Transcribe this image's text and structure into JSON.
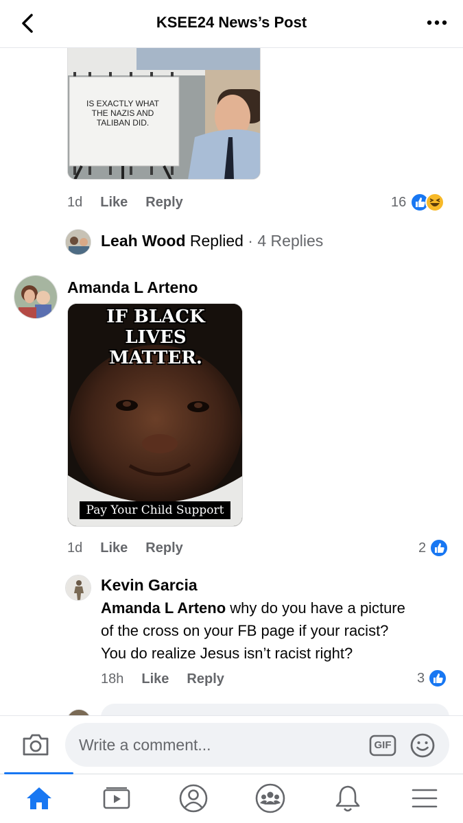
{
  "header": {
    "title": "KSEE24 News’s Post",
    "back_icon": "chevron-left-icon",
    "more_icon": "more-dots-icon"
  },
  "first_comment": {
    "image_text": "IS EXACTLY WHAT THE NAZIS AND TALIBAN DID.",
    "time": "1d",
    "like": "Like",
    "reply": "Reply",
    "reaction_count": "16"
  },
  "replies_summary": {
    "name": "Leah Wood",
    "replied": "Replied",
    "separator": "·",
    "count_text": "4 Replies"
  },
  "second_comment": {
    "author": "Amanda L Arteno",
    "image_text_top": "IF BLACK LIVES MATTER.",
    "image_text_bottom": "Pay Your Child Support",
    "time": "1d",
    "like": "Like",
    "reply": "Reply",
    "reaction_count": "2"
  },
  "reply_comment": {
    "author": "Kevin Garcia",
    "mention": "Amanda L Arteno",
    "text_line1": "why do you have a picture",
    "text_line2": "of the cross on your FB page if your racist?",
    "text_line3": "You do realize Jesus isn’t racist right?",
    "time": "18h",
    "like": "Like",
    "reply": "Reply",
    "reaction_count": "3"
  },
  "composer": {
    "placeholder": "Write a comment...",
    "gif_label": "GIF"
  },
  "tabs": [
    "home-icon",
    "video-icon",
    "profile-icon",
    "groups-icon",
    "bell-icon",
    "menu-icon"
  ],
  "colors": {
    "accent": "#1877f2",
    "like_blue": "#1877f2",
    "haha_yellow": "#f7b928",
    "muted_text": "#65676b"
  }
}
